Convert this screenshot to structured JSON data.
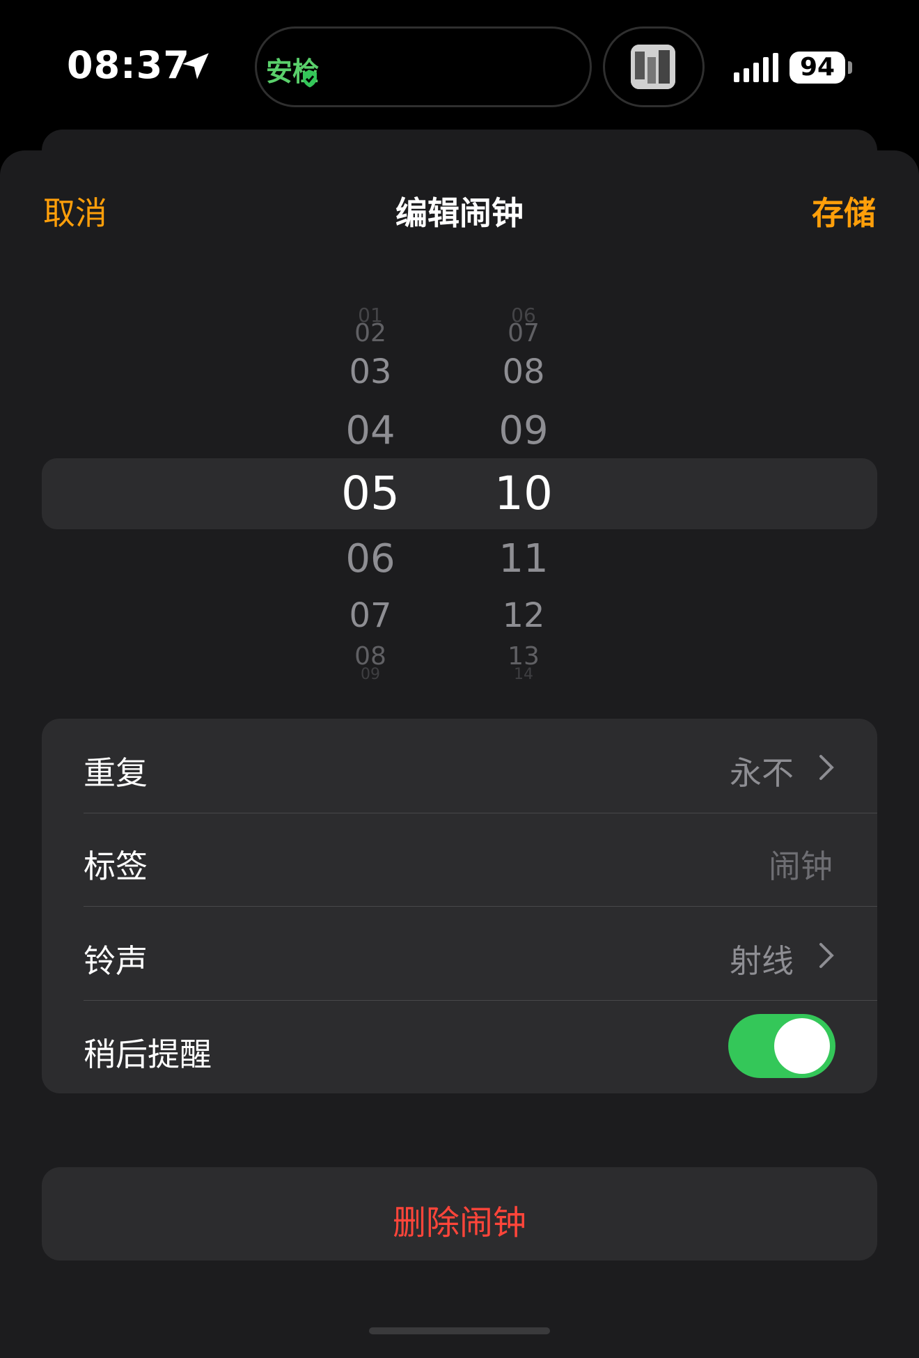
{
  "status_bar": {
    "time": "08:37",
    "island_label": "安检",
    "battery": "94"
  },
  "nav": {
    "cancel_label": "取消",
    "title": "编辑闹钟",
    "save_label": "存储"
  },
  "picker": {
    "hours": [
      "01",
      "02",
      "03",
      "04",
      "05",
      "06",
      "07",
      "08",
      "09"
    ],
    "minutes": [
      "06",
      "07",
      "08",
      "09",
      "10",
      "11",
      "12",
      "13",
      "14"
    ],
    "selected_hour": "05",
    "selected_minute": "10"
  },
  "settings": {
    "repeat": {
      "label": "重复",
      "value": "永不"
    },
    "label_row": {
      "label": "标签",
      "value": "闹钟"
    },
    "sound": {
      "label": "铃声",
      "value": "射线"
    },
    "snooze": {
      "label": "稍后提醒",
      "on": true
    }
  },
  "delete_label": "删除闹钟",
  "colors": {
    "accent": "#ff9f0a",
    "destructive": "#ff453a",
    "toggle_on": "#34c759",
    "island_text": "#5ad06b"
  }
}
